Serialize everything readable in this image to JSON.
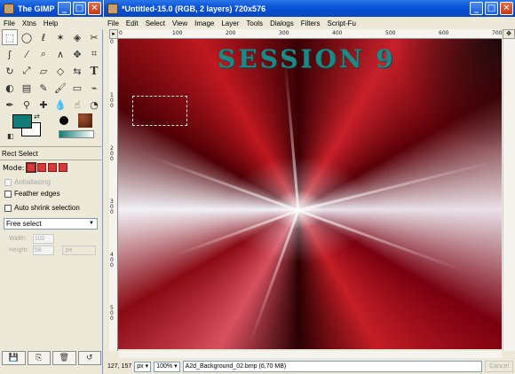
{
  "toolbox": {
    "title": "The GIMP",
    "menu": [
      "File",
      "Xtns",
      "Help"
    ],
    "window_buttons": [
      "_",
      "□",
      "✕"
    ],
    "tools": [
      {
        "name": "rect-select-tool",
        "glyph": "⬚"
      },
      {
        "name": "ellipse-select-tool",
        "glyph": "◯"
      },
      {
        "name": "lasso-tool",
        "glyph": "ℓ"
      },
      {
        "name": "fuzzy-select-tool",
        "glyph": "✶"
      },
      {
        "name": "color-select-tool",
        "glyph": "◈"
      },
      {
        "name": "scissors-tool",
        "glyph": "✂"
      },
      {
        "name": "paths-tool",
        "glyph": "ʃ"
      },
      {
        "name": "color-picker-tool",
        "glyph": "⁄"
      },
      {
        "name": "zoom-tool",
        "glyph": "⌕"
      },
      {
        "name": "measure-tool",
        "glyph": "∧"
      },
      {
        "name": "move-tool",
        "glyph": "✥"
      },
      {
        "name": "crop-tool",
        "glyph": "⌗"
      },
      {
        "name": "rotate-tool",
        "glyph": "↻"
      },
      {
        "name": "scale-tool",
        "glyph": "⤢"
      },
      {
        "name": "shear-tool",
        "glyph": "▱"
      },
      {
        "name": "perspective-tool",
        "glyph": "◇"
      },
      {
        "name": "flip-tool",
        "glyph": "⇆"
      },
      {
        "name": "text-tool",
        "glyph": "T"
      },
      {
        "name": "bucket-fill-tool",
        "glyph": "◐"
      },
      {
        "name": "blend-tool",
        "glyph": "▤"
      },
      {
        "name": "pencil-tool",
        "glyph": "✎"
      },
      {
        "name": "paintbrush-tool",
        "glyph": "🖌"
      },
      {
        "name": "eraser-tool",
        "glyph": "▭"
      },
      {
        "name": "airbrush-tool",
        "glyph": "⌁"
      },
      {
        "name": "ink-tool",
        "glyph": "✒"
      },
      {
        "name": "clone-tool",
        "glyph": "⚲"
      },
      {
        "name": "heal-tool",
        "glyph": "✚"
      },
      {
        "name": "convolve-tool",
        "glyph": "💧"
      },
      {
        "name": "smudge-tool",
        "glyph": "☝"
      },
      {
        "name": "dodge-burn-tool",
        "glyph": "◔"
      }
    ],
    "colors": {
      "foreground": "#147c78",
      "background": "#ffffff"
    },
    "tool_options": {
      "title": "Rect Select",
      "mode_label": "Mode:",
      "antialiasing_label": "Antialiasing",
      "feather_label": "Feather edges",
      "auto_shrink_label": "Auto shrink selection",
      "select_type": "Free select",
      "width_label": "Width:",
      "width_value": "102",
      "height_label": "Height:",
      "height_value": "58",
      "unit": "px"
    }
  },
  "image_window": {
    "title": "*Untitled-15.0 (RGB, 2 layers) 720x576",
    "menu": [
      "File",
      "Edit",
      "Select",
      "View",
      "Image",
      "Layer",
      "Tools",
      "Dialogs",
      "Filters",
      "Script-Fu"
    ],
    "window_buttons": [
      "_",
      "□",
      "✕"
    ],
    "ruler_h_labels": [
      "0",
      "100",
      "200",
      "300",
      "400",
      "500",
      "600",
      "700"
    ],
    "ruler_v_labels": [
      "0",
      "1\n0\n0",
      "2\n0\n0",
      "3\n0\n0",
      "4\n0\n0",
      "5\n0\n0"
    ],
    "canvas_text": "SESSION 9",
    "status": {
      "coords": "127, 157",
      "unit": "px",
      "zoom": "100%",
      "file": "A2d_Background_02.bmp (6,70 MB)",
      "cancel": "Cancel"
    }
  }
}
